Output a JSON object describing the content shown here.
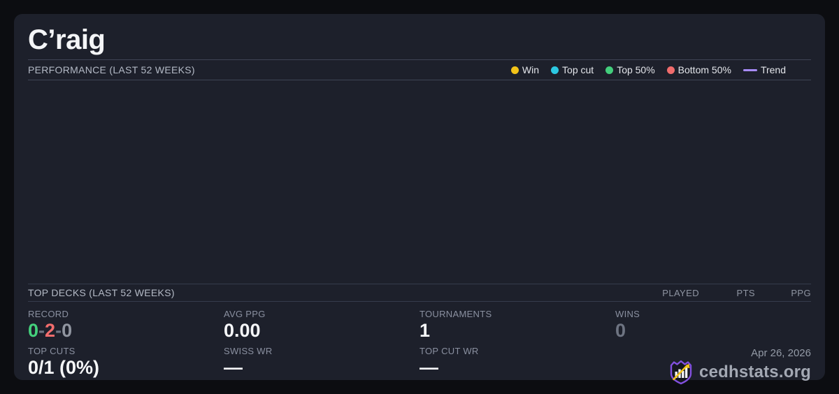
{
  "card": {
    "title": "C’raig",
    "performance": {
      "header": "PERFORMANCE (LAST 52 WEEKS)",
      "legend": [
        {
          "label": "Win",
          "color": "#f2c318",
          "swatch": "dot"
        },
        {
          "label": "Top cut",
          "color": "#2cc8e2",
          "swatch": "dot"
        },
        {
          "label": "Top 50%",
          "color": "#43ce7c",
          "swatch": "dot"
        },
        {
          "label": "Bottom 50%",
          "color": "#f06c6c",
          "swatch": "dot"
        },
        {
          "label": "Trend",
          "color": "#a78bfa",
          "swatch": "line"
        }
      ],
      "chart_empty": true
    },
    "top_decks": {
      "header": "TOP DECKS (LAST 52 WEEKS)",
      "columns": [
        "PLAYED",
        "PTS",
        "PPG"
      ],
      "rows": []
    },
    "stats": {
      "record": {
        "label": "RECORD",
        "wins": "0",
        "losses": "2",
        "draws": "0",
        "separator": "-"
      },
      "avg_ppg": {
        "label": "AVG PPG",
        "value": "0.00"
      },
      "tournaments": {
        "label": "TOURNAMENTS",
        "value": "1"
      },
      "wins": {
        "label": "WINS",
        "value": "0"
      },
      "top_cuts": {
        "label": "TOP CUTS",
        "value": "0/1 (0%)"
      },
      "swiss_wr": {
        "label": "SWISS WR",
        "value": "—"
      },
      "top_cut_wr": {
        "label": "TOP CUT WR",
        "value": "—"
      }
    },
    "footer": {
      "date": "Apr 26, 2026",
      "brand": "cedhstats.org"
    }
  },
  "colors": {
    "page_bg": "#0c0d11",
    "card_bg": "#1d202b",
    "divider": "#3e4455",
    "legend_win": "#f2c318",
    "legend_top_cut": "#2cc8e2",
    "legend_top50": "#43ce7c",
    "legend_bottom50": "#f06c6c",
    "legend_trend": "#a78bfa",
    "record_win": "#44d17c",
    "record_loss": "#f26d6d",
    "record_draw": "#9095a0",
    "muted_value": "#6e7482",
    "logo_purple": "#8250df",
    "logo_gold": "#f2c318"
  }
}
